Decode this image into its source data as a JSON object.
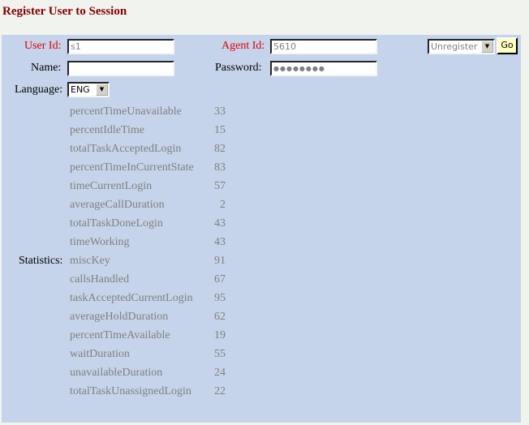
{
  "page": {
    "title": "Register User to Session"
  },
  "form": {
    "user_id_label": "User Id:",
    "user_id_value": "s1",
    "agent_id_label": "Agent Id:",
    "agent_id_value": "5610",
    "name_label": "Name:",
    "name_value": "",
    "password_label": "Password:",
    "password_value": "●●●●●●●●",
    "language_label": "Language:",
    "language_selected": "ENG",
    "action_selected": "Unregister",
    "go_label": "Go"
  },
  "statistics": {
    "label": "Statistics:",
    "items": [
      {
        "name": "percentTimeUnavailable",
        "value": "33"
      },
      {
        "name": "percentIdleTime",
        "value": "15"
      },
      {
        "name": "totalTaskAcceptedLogin",
        "value": "82"
      },
      {
        "name": "percentTimeInCurrentState",
        "value": "83"
      },
      {
        "name": "timeCurrentLogin",
        "value": "57"
      },
      {
        "name": "averageCallDuration",
        "value": "2"
      },
      {
        "name": "totalTaskDoneLogin",
        "value": "43"
      },
      {
        "name": "timeWorking",
        "value": "43"
      },
      {
        "name": "miscKey",
        "value": "91"
      },
      {
        "name": "callsHandled",
        "value": "67"
      },
      {
        "name": "taskAcceptedCurrentLogin",
        "value": "95"
      },
      {
        "name": "averageHoldDuration",
        "value": "62"
      },
      {
        "name": "percentTimeAvailable",
        "value": "19"
      },
      {
        "name": "waitDuration",
        "value": "55"
      },
      {
        "name": "unavailableDuration",
        "value": "24"
      },
      {
        "name": "totalTaskUnassignedLogin",
        "value": "22"
      }
    ]
  }
}
